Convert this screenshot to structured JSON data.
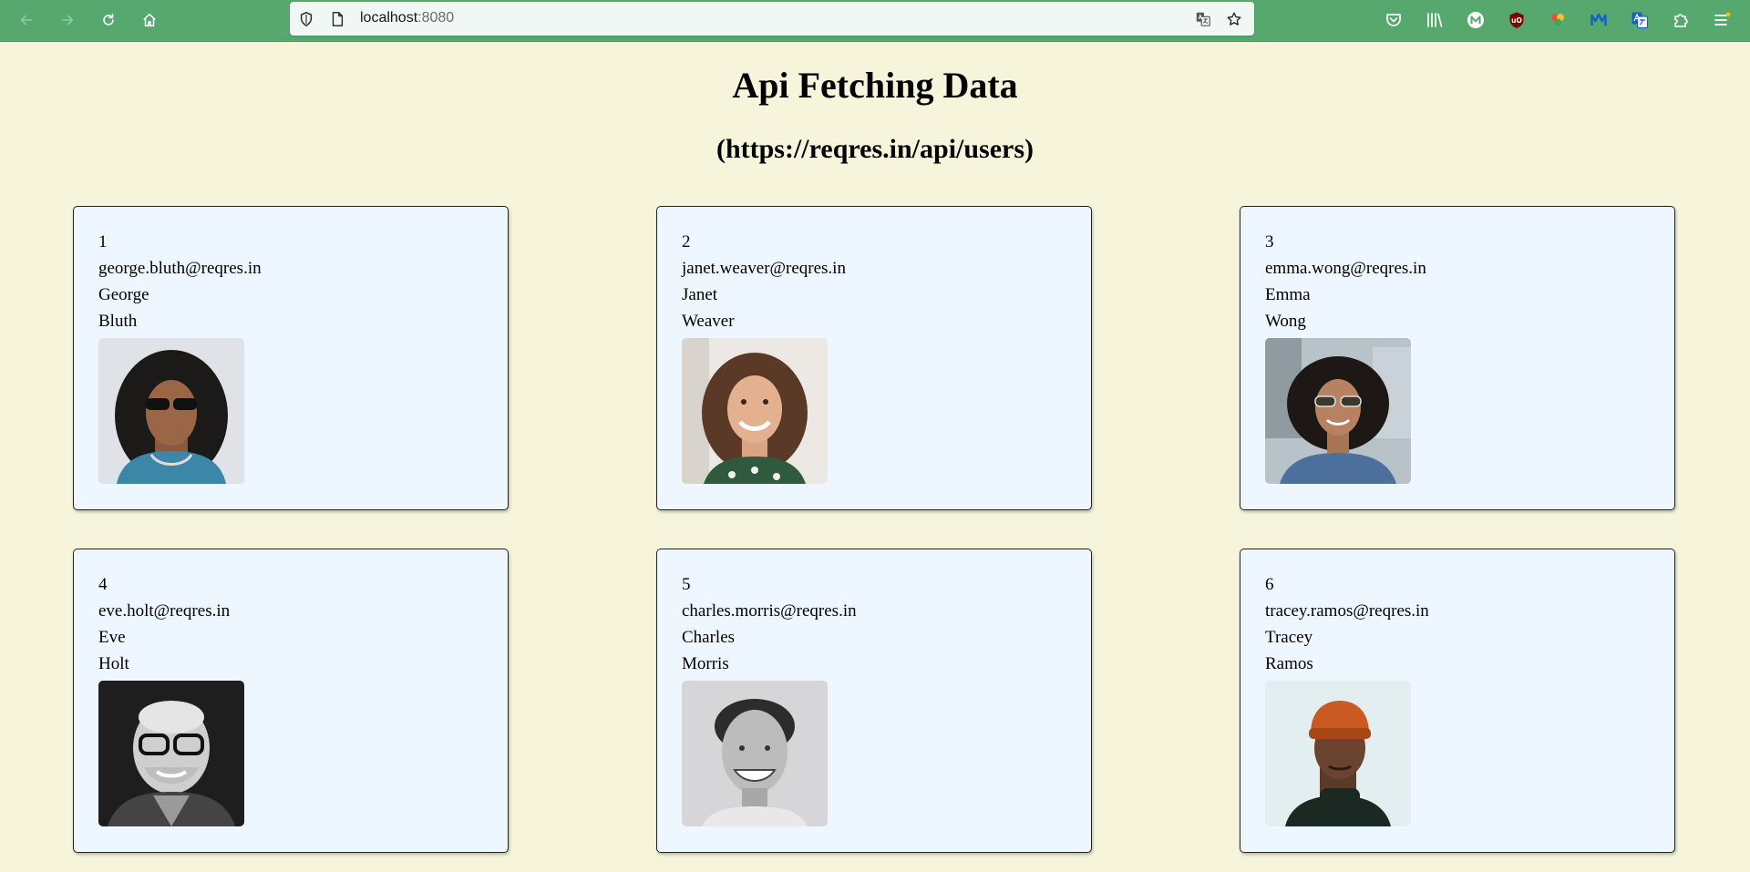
{
  "browser": {
    "url_host": "localhost",
    "url_port": ":8080"
  },
  "page": {
    "title": "Api Fetching Data",
    "subtitle": "(https://reqres.in/api/users)"
  },
  "users": [
    {
      "id": "1",
      "email": "george.bluth@reqres.in",
      "first_name": "George",
      "last_name": "Bluth"
    },
    {
      "id": "2",
      "email": "janet.weaver@reqres.in",
      "first_name": "Janet",
      "last_name": "Weaver"
    },
    {
      "id": "3",
      "email": "emma.wong@reqres.in",
      "first_name": "Emma",
      "last_name": "Wong"
    },
    {
      "id": "4",
      "email": "eve.holt@reqres.in",
      "first_name": "Eve",
      "last_name": "Holt"
    },
    {
      "id": "5",
      "email": "charles.morris@reqres.in",
      "first_name": "Charles",
      "last_name": "Morris"
    },
    {
      "id": "6",
      "email": "tracey.ramos@reqres.in",
      "first_name": "Tracey",
      "last_name": "Ramos"
    }
  ],
  "colors": {
    "toolbar": "#56a86f",
    "page_background": "#f6f5dc",
    "card_background": "#eef6ff"
  }
}
